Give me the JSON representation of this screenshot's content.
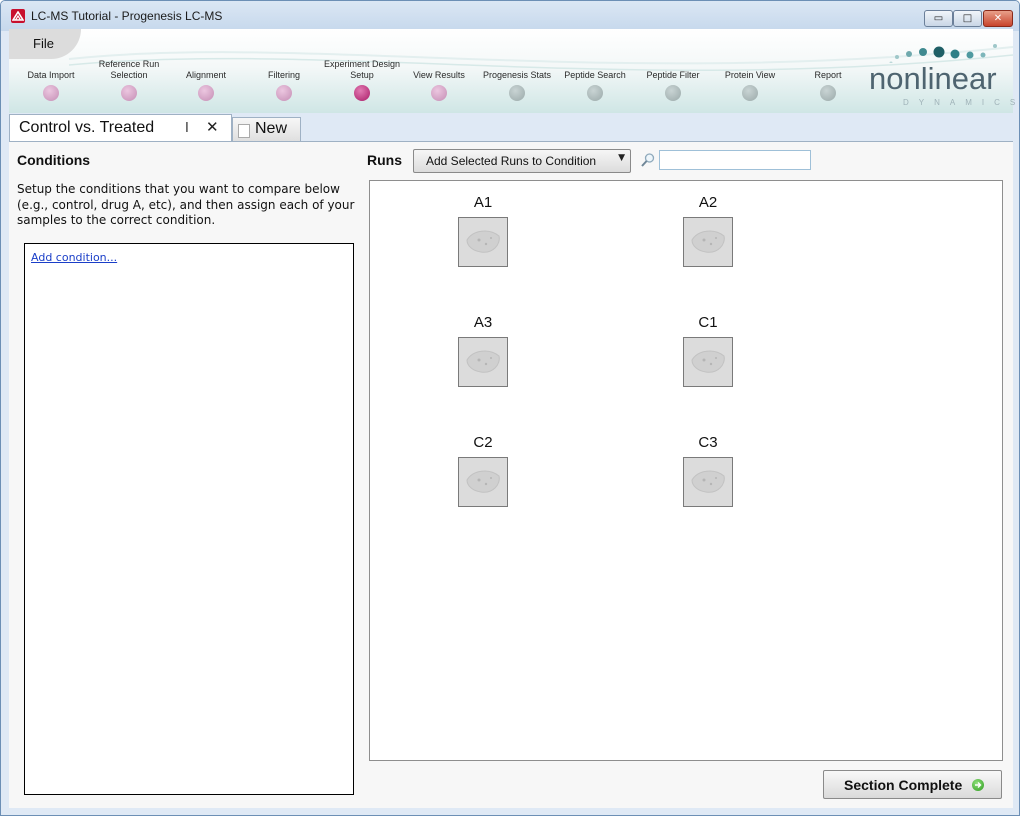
{
  "window": {
    "title": "LC-MS Tutorial - Progenesis LC-MS",
    "controls": {
      "minimize": "▭",
      "maximize": "□",
      "close": "✕"
    }
  },
  "menu": {
    "file": "File"
  },
  "workflow": {
    "steps": [
      {
        "label": "Data Import",
        "state": "done"
      },
      {
        "label": "Reference Run Selection",
        "state": "done"
      },
      {
        "label": "Alignment",
        "state": "done"
      },
      {
        "label": "Filtering",
        "state": "done"
      },
      {
        "label": "Experiment Design Setup",
        "state": "current"
      },
      {
        "label": "View Results",
        "state": "done"
      },
      {
        "label": "Progenesis Stats",
        "state": "todo"
      },
      {
        "label": "Peptide Search",
        "state": "todo"
      },
      {
        "label": "Peptide Filter",
        "state": "todo"
      },
      {
        "label": "Protein View",
        "state": "todo"
      },
      {
        "label": "Report",
        "state": "todo"
      }
    ]
  },
  "logo": {
    "main": "nonlinear",
    "sub": "DYNAMICS"
  },
  "tabs": {
    "active_label": "Control vs. Treated",
    "close_glyph": "✕",
    "new_label": "New"
  },
  "conditions": {
    "title": "Conditions",
    "description": "Setup the conditions that you want to compare below (e.g., control, drug A, etc), and then assign each of your samples to the correct condition.",
    "add_link": "Add condition..."
  },
  "runs": {
    "title": "Runs",
    "add_button": "Add Selected Runs to Condition",
    "search_value": "",
    "items": [
      {
        "label": "A1"
      },
      {
        "label": "A2"
      },
      {
        "label": "A3"
      },
      {
        "label": "C1"
      },
      {
        "label": "C2"
      },
      {
        "label": "C3"
      }
    ]
  },
  "footer": {
    "section_complete": "Section Complete"
  },
  "colors": {
    "step_done": "#c48db4",
    "step_current": "#a91a66",
    "step_todo": "#9aa9a9",
    "logo_dots": "#2f7f86",
    "link": "#1a3ec8"
  }
}
